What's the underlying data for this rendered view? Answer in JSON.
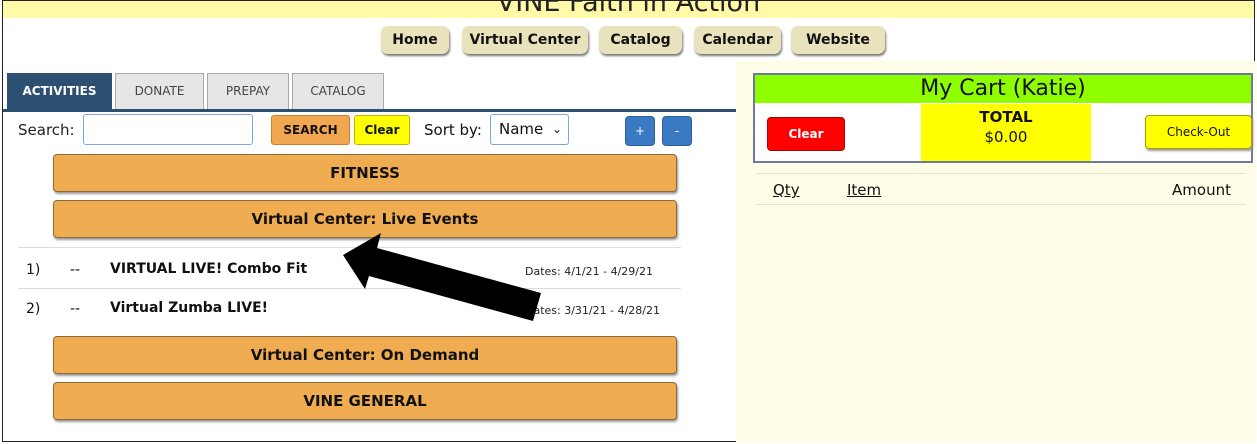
{
  "banner": {
    "title": "VINE Faith in Action"
  },
  "nav": {
    "items": [
      {
        "label": "Home"
      },
      {
        "label": "Virtual Center"
      },
      {
        "label": "Catalog"
      },
      {
        "label": "Calendar"
      },
      {
        "label": "Website"
      }
    ]
  },
  "tabs": [
    {
      "label": "ACTIVITIES",
      "active": true
    },
    {
      "label": "DONATE"
    },
    {
      "label": "PREPAY"
    },
    {
      "label": "CATALOG"
    }
  ],
  "search": {
    "label": "Search:",
    "value": "",
    "placeholder": "",
    "search_button": "SEARCH",
    "clear_button": "Clear",
    "sort_label": "Sort by:",
    "sort_value": "Name",
    "expand_button": "+",
    "collapse_button": "-"
  },
  "categories": {
    "fitness": "FITNESS",
    "live_events": "Virtual Center: Live Events",
    "on_demand": "Virtual Center: On Demand",
    "general": "VINE GENERAL"
  },
  "activities": [
    {
      "num": "1)",
      "dash": "--",
      "name": "VIRTUAL LIVE! Combo Fit",
      "dates": "Dates: 4/1/21 - 4/29/21"
    },
    {
      "num": "2)",
      "dash": "--",
      "name": "Virtual Zumba LIVE!",
      "dates": "Dates: 3/31/21 - 4/28/21"
    }
  ],
  "cart": {
    "title": "My Cart (Katie)",
    "clear_button": "Clear",
    "total_label": "TOTAL",
    "total_amount": "$0.00",
    "checkout_button": "Check-Out",
    "columns": {
      "qty": "Qty",
      "item": "Item",
      "amount": "Amount"
    }
  },
  "colors": {
    "tab_active": "#2d4f72",
    "category_button": "#f0ac50",
    "cart_title": "#8fff00",
    "total_bg": "#ffff00",
    "clear_red": "#ff0000"
  }
}
